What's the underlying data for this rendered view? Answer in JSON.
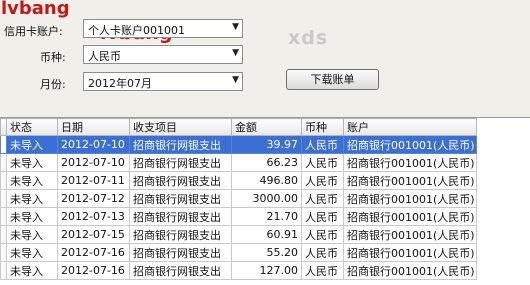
{
  "watermarks": {
    "top_left": "lvbang",
    "center": "lvbang",
    "right": "xds"
  },
  "form": {
    "account_label": "信用卡账户:",
    "account_value": "个人卡账户001001",
    "currency_label": "币种:",
    "currency_value": "人民币",
    "month_label": "月份:",
    "month_value": "2012年07月",
    "download_label": "下载账单"
  },
  "table": {
    "headers": [
      "状态",
      "日期",
      "收支项目",
      "金额",
      "币种",
      "账户"
    ],
    "rows": [
      {
        "status": "未导入",
        "date": "2012-07-10",
        "item": "招商银行网银支出",
        "amount": "39.97",
        "currency": "人民币",
        "account": "招商银行001001(人民币)"
      },
      {
        "status": "未导入",
        "date": "2012-07-10",
        "item": "招商银行网银支出",
        "amount": "66.23",
        "currency": "人民币",
        "account": "招商银行001001(人民币)"
      },
      {
        "status": "未导入",
        "date": "2012-07-11",
        "item": "招商银行网银支出",
        "amount": "496.80",
        "currency": "人民币",
        "account": "招商银行001001(人民币)"
      },
      {
        "status": "未导入",
        "date": "2012-07-12",
        "item": "招商银行网银支出",
        "amount": "3000.00",
        "currency": "人民币",
        "account": "招商银行001001(人民币)"
      },
      {
        "status": "未导入",
        "date": "2012-07-13",
        "item": "招商银行网银支出",
        "amount": "21.70",
        "currency": "人民币",
        "account": "招商银行001001(人民币)"
      },
      {
        "status": "未导入",
        "date": "2012-07-15",
        "item": "招商银行网银支出",
        "amount": "60.91",
        "currency": "人民币",
        "account": "招商银行001001(人民币)"
      },
      {
        "status": "未导入",
        "date": "2012-07-16",
        "item": "招商银行网银支出",
        "amount": "55.20",
        "currency": "人民币",
        "account": "招商银行001001(人民币)"
      },
      {
        "status": "未导入",
        "date": "2012-07-16",
        "item": "招商银行网银支出",
        "amount": "127.00",
        "currency": "人民币",
        "account": "招商银行001001(人民币)"
      }
    ]
  }
}
